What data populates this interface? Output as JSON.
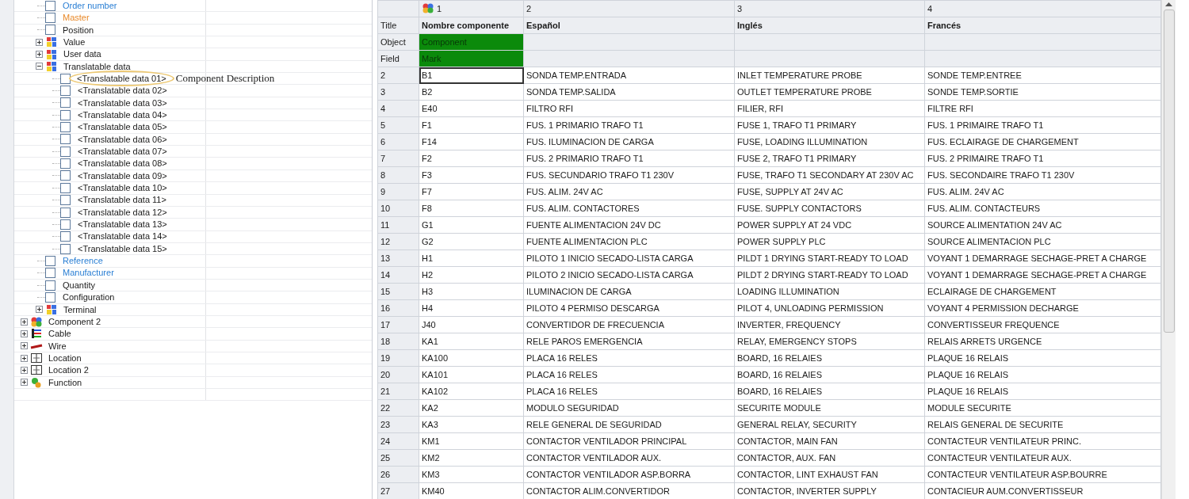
{
  "tree": {
    "partial_branch": [
      {
        "kind": "field",
        "label": "Order number",
        "checked": false,
        "color": "#2a7fd4"
      },
      {
        "kind": "field",
        "label": "Master",
        "checked": false,
        "color": "#e8892a"
      },
      {
        "kind": "field",
        "label": "Position",
        "checked": false
      },
      {
        "kind": "data-group",
        "label": "Value",
        "expanded": false
      },
      {
        "kind": "data-group",
        "label": "User data",
        "expanded": false
      },
      {
        "kind": "data-group",
        "label": "Translatable data",
        "expanded": true,
        "children": [
          {
            "kind": "field",
            "label": "<Translatable data 01>",
            "checked": false,
            "annotation": "Component Description"
          },
          {
            "kind": "field",
            "label": "<Translatable data 02>",
            "checked": false
          },
          {
            "kind": "field",
            "label": "<Translatable data 03>",
            "checked": false
          },
          {
            "kind": "field",
            "label": "<Translatable data 04>",
            "checked": false
          },
          {
            "kind": "field",
            "label": "<Translatable data 05>",
            "checked": false
          },
          {
            "kind": "field",
            "label": "<Translatable data 06>",
            "checked": false
          },
          {
            "kind": "field",
            "label": "<Translatable data 07>",
            "checked": false
          },
          {
            "kind": "field",
            "label": "<Translatable data 08>",
            "checked": false
          },
          {
            "kind": "field",
            "label": "<Translatable data 09>",
            "checked": false
          },
          {
            "kind": "field",
            "label": "<Translatable data 10>",
            "checked": false
          },
          {
            "kind": "field",
            "label": "<Translatable data 11>",
            "checked": false
          },
          {
            "kind": "field",
            "label": "<Translatable data 12>",
            "checked": false
          },
          {
            "kind": "field",
            "label": "<Translatable data 13>",
            "checked": false
          },
          {
            "kind": "field",
            "label": "<Translatable data 14>",
            "checked": false
          },
          {
            "kind": "field",
            "label": "<Translatable data 15>",
            "checked": false
          }
        ]
      },
      {
        "kind": "field",
        "label": "Reference",
        "checked": false,
        "color": "#2a7fd4"
      },
      {
        "kind": "field",
        "label": "Manufacturer",
        "checked": false,
        "color": "#2a7fd4"
      },
      {
        "kind": "field",
        "label": "Quantity",
        "checked": false
      },
      {
        "kind": "field",
        "label": "Configuration",
        "checked": false
      },
      {
        "kind": "data-group",
        "label": "Terminal",
        "expanded": false
      }
    ],
    "items": [
      {
        "kind": "component",
        "label": "Component 2",
        "expanded": false
      },
      {
        "kind": "cable",
        "label": "Cable",
        "expanded": false
      },
      {
        "kind": "wire",
        "label": "Wire",
        "expanded": false
      },
      {
        "kind": "location",
        "label": "Location",
        "expanded": false
      },
      {
        "kind": "location",
        "label": "Location 2",
        "expanded": false
      },
      {
        "kind": "function",
        "label": "Function",
        "expanded": false
      }
    ]
  },
  "table": {
    "columns": [
      "1",
      "2",
      "3",
      "4"
    ],
    "meta_rows": [
      {
        "kind": "title",
        "label": "Title",
        "cells": [
          {
            "text": "Nombre componente",
            "highlighted": false
          },
          {
            "text": "Español",
            "highlighted": false
          },
          {
            "text": "Inglés",
            "highlighted": false
          },
          {
            "text": "Francés",
            "highlighted": false
          }
        ]
      },
      {
        "kind": "mapping",
        "label": "Object",
        "cells": [
          {
            "text": "Component",
            "highlighted": true
          },
          {
            "highlighted": false
          },
          {
            "highlighted": false
          },
          {
            "highlighted": false
          }
        ]
      },
      {
        "kind": "mapping",
        "label": "Field",
        "cells": [
          {
            "text": "Mark",
            "highlighted": true
          },
          {
            "highlighted": false
          },
          {
            "highlighted": false
          },
          {
            "highlighted": false
          }
        ]
      }
    ],
    "rows": [
      {
        "num": "2",
        "selected": true,
        "cells": [
          "B1",
          "SONDA TEMP.ENTRADA",
          "INLET TEMPERATURE PROBE",
          "SONDE TEMP.ENTREE"
        ]
      },
      {
        "num": "3",
        "selected": false,
        "cells": [
          "B2",
          "SONDA TEMP.SALIDA",
          "OUTLET TEMPERATURE PROBE",
          "SONDE TEMP.SORTIE"
        ]
      },
      {
        "num": "4",
        "selected": false,
        "cells": [
          "E40",
          "FILTRO RFI",
          "FILIER, RFI",
          "FILTRE RFI"
        ]
      },
      {
        "num": "5",
        "selected": false,
        "cells": [
          "F1",
          "FUS. 1 PRIMARIO TRAFO T1",
          "FUSE 1, TRAFO T1 PRIMARY",
          "FUS. 1 PRIMAIRE TRAFO T1"
        ]
      },
      {
        "num": "6",
        "selected": false,
        "cells": [
          "F14",
          "FUS. ILUMINACION DE CARGA",
          "FUSE, LOADING ILLUMINATION",
          "FUS. ECLAIRAGE DE CHARGEMENT"
        ]
      },
      {
        "num": "7",
        "selected": false,
        "cells": [
          "F2",
          "FUS. 2 PRIMARIO TRAFO T1",
          "FUSE 2, TRAFO T1 PRIMARY",
          "FUS. 2 PRIMAIRE TRAFO T1"
        ]
      },
      {
        "num": "8",
        "selected": false,
        "cells": [
          "F3",
          "FUS. SECUNDARIO TRAFO T1 230V",
          "FUSE, TRAFO T1 SECONDARY AT 230V AC",
          "FUS. SECONDAIRE TRAFO T1 230V"
        ]
      },
      {
        "num": "9",
        "selected": false,
        "cells": [
          "F7",
          "FUS. ALIM. 24V AC",
          "FUSE, SUPPLY AT 24V AC",
          "FUS. ALIM. 24V AC"
        ]
      },
      {
        "num": "10",
        "selected": false,
        "cells": [
          "F8",
          "FUS. ALIM. CONTACTORES",
          "FUSE. SUPPLY CONTACTORS",
          "FUS. ALIM. CONTACTEURS"
        ]
      },
      {
        "num": "11",
        "selected": false,
        "cells": [
          "G1",
          "FUENTE ALIMENTACION 24V DC",
          "POWER SUPPLY AT 24 VDC",
          "SOURCE ALIMENTATION 24V AC"
        ]
      },
      {
        "num": "12",
        "selected": false,
        "cells": [
          "G2",
          "FUENTE ALIMENTACION PLC",
          "POWER SUPPLY PLC",
          "SOURCE ALIMENTACION PLC"
        ]
      },
      {
        "num": "13",
        "selected": false,
        "cells": [
          "H1",
          "PILOTO 1 INICIO SECADO-LISTA CARGA",
          "PILDT 1 DRYING START-READY TO LOAD",
          "VOYANT 1 DEMARRAGE SECHAGE-PRET A CHARGE"
        ]
      },
      {
        "num": "14",
        "selected": false,
        "cells": [
          "H2",
          "PILOTO 2 INICIO SECADO-LISTA CARGA",
          "PILDT 2 DRYING START-READY TO LOAD",
          "VOYANT 1 DEMARRAGE SECHAGE-PRET A CHARGE"
        ]
      },
      {
        "num": "15",
        "selected": false,
        "cells": [
          "H3",
          "ILUMINACION DE CARGA",
          "LOADING ILLUMINATION",
          "ECLAIRAGE DE CHARGEMENT"
        ]
      },
      {
        "num": "16",
        "selected": false,
        "cells": [
          "H4",
          "PILOTO 4 PERMISO DESCARGA",
          "PILOT 4, UNLOADING PERMISSION",
          "VOYANT 4 PERMISSION DECHARGE"
        ]
      },
      {
        "num": "17",
        "selected": false,
        "cells": [
          "J40",
          "CONVERTIDOR DE FRECUENCIA",
          "INVERTER, FREQUENCY",
          "CONVERTISSEUR FREQUENCE"
        ]
      },
      {
        "num": "18",
        "selected": false,
        "cells": [
          "KA1",
          "RELE PAROS EMERGENCIA",
          "RELAY, EMERGENCY STOPS",
          "RELAIS ARRETS URGENCE"
        ]
      },
      {
        "num": "19",
        "selected": false,
        "cells": [
          "KA100",
          "PLACA 16 RELES",
          "BOARD, 16 RELAIES",
          "PLAQUE 16 RELAIS"
        ]
      },
      {
        "num": "20",
        "selected": false,
        "cells": [
          "KA101",
          "PLACA 16 RELES",
          "BOARD, 16 RELAIES",
          "PLAQUE 16 RELAIS"
        ]
      },
      {
        "num": "21",
        "selected": false,
        "cells": [
          "KA102",
          "PLACA 16 RELES",
          "BOARD, 16 RELAIES",
          "PLAQUE 16 RELAIS"
        ]
      },
      {
        "num": "22",
        "selected": false,
        "cells": [
          "KA2",
          "MODULO SEGURIDAD",
          "SECURITE MODULE",
          "MODULE SECURITE"
        ]
      },
      {
        "num": "23",
        "selected": false,
        "cells": [
          "KA3",
          "RELE GENERAL DE SEGURIDAD",
          "GENERAL RELAY, SECURITY",
          "RELAIS GENERAL DE SECURITE"
        ]
      },
      {
        "num": "24",
        "selected": false,
        "cells": [
          "KM1",
          "CONTACTOR VENTILADOR PRINCIPAL",
          "CONTACTOR, MAIN FAN",
          "CONTACTEUR VENTILATEUR PRINC."
        ]
      },
      {
        "num": "25",
        "selected": false,
        "cells": [
          "KM2",
          "CONTACTOR VENTILADOR AUX.",
          "CONTACTOR, AUX. FAN",
          "CONTACTEUR VENTILATEUR AUX."
        ]
      },
      {
        "num": "26",
        "selected": false,
        "cells": [
          "KM3",
          "CONTACTOR VENTILADOR ASP.BORRA",
          "CONTACTOR, LINT EXHAUST FAN",
          "CONTACTEUR VENTILATEUR ASP.BOURRE"
        ]
      },
      {
        "num": "27",
        "selected": false,
        "cells": [
          "KM40",
          "CONTACTOR ALIM.CONVERTIDOR",
          "CONTACTOR, INVERTER SUPPLY",
          "CONTACIEUR AUM.CONVERTISSEUR"
        ]
      }
    ]
  }
}
